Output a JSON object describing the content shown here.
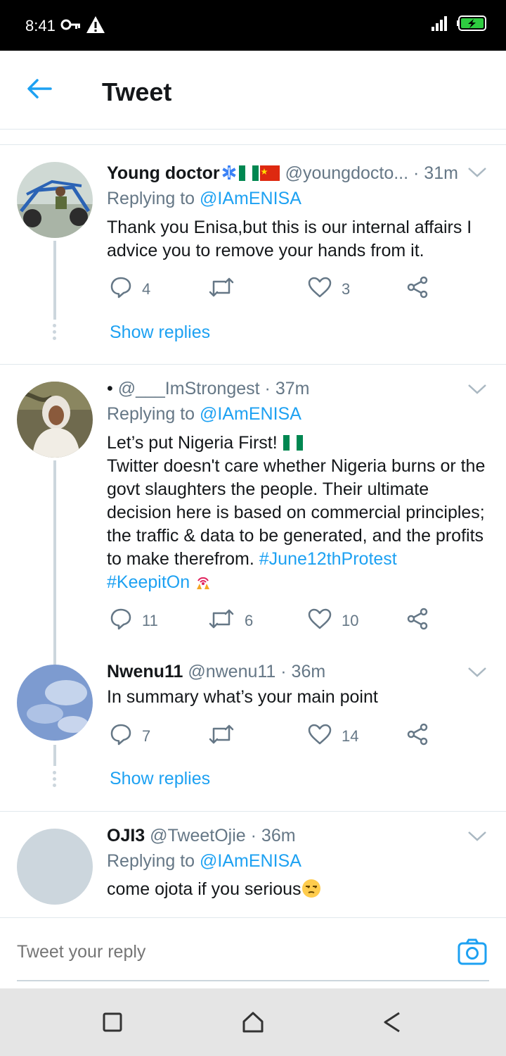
{
  "status_bar": {
    "time": "8:41",
    "left_icons": [
      "key-icon",
      "warning-icon"
    ],
    "right_icons": [
      "signal-icon",
      "battery-charging-icon"
    ]
  },
  "header": {
    "title": "Tweet",
    "back_icon": "back-arrow-icon"
  },
  "tweets": [
    {
      "name": "Young doctor",
      "name_badges": [
        "medical-star-icon",
        "nigeria-flag-icon",
        "china-flag-icon"
      ],
      "handle": "@youngdocto...",
      "time": "· 31m",
      "reply_to_prefix": "Replying to ",
      "reply_to": "@IAmENISA",
      "text": "Thank you Enisa,but this is our internal affairs I advice you to remove your hands from it.",
      "replies": "4",
      "retweets": "",
      "likes": "3",
      "show_replies": "Show replies"
    },
    {
      "name": "",
      "name_prefix": "•",
      "handle": "@___ImStrongest",
      "time": "· 37m",
      "reply_to_prefix": "Replying to ",
      "reply_to": "@IAmENISA",
      "line1": "Let’s put Nigeria First!",
      "line1_emoji": "nigeria-flag-icon",
      "text": "Twitter doesn't care whether Nigeria burns or the govt slaughters the people. Their ultimate decision here is based on commercial principles; the traffic & data to be generated, and the profits to make therefrom.",
      "hashtag1": "#June12thProtest",
      "hashtag2": "#KeepitOn",
      "hashtag2_emoji": "signal-hands-icon",
      "replies": "11",
      "retweets": "6",
      "likes": "10"
    },
    {
      "name": "Nwenu11",
      "handle": "@nwenu11",
      "time": "· 36m",
      "text": "In summary what’s your main point",
      "replies": "7",
      "retweets": "",
      "likes": "14",
      "show_replies": "Show replies"
    },
    {
      "name": "OJI3",
      "handle": "@TweetOjie",
      "time": "· 36m",
      "reply_to_prefix": "Replying to ",
      "reply_to": "@IAmENISA",
      "text": "come ojota if you serious",
      "text_emoji": "unamused-face-icon"
    }
  ],
  "compose": {
    "placeholder": "Tweet your reply",
    "camera_icon": "camera-icon"
  },
  "nav_bar": [
    "recents-square-icon",
    "home-house-icon",
    "back-triangle-icon"
  ],
  "colors": {
    "accent": "#1da1f2",
    "secondary_text": "#657786",
    "primary_text": "#14171a",
    "divider": "#e1e8ed"
  }
}
